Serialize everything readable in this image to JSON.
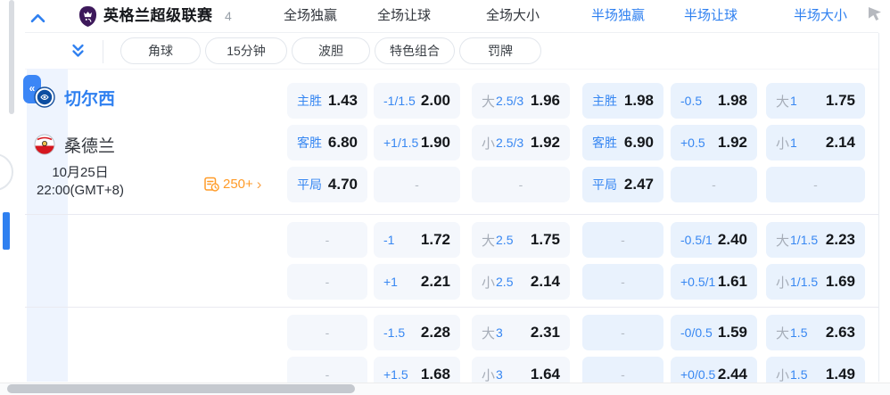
{
  "header": {
    "league_name": "英格兰超级联赛",
    "match_count": "4",
    "market_tabs": [
      {
        "label": "全场独赢",
        "highlighted": false
      },
      {
        "label": "全场让球",
        "highlighted": false
      },
      {
        "label": "全场大小",
        "highlighted": false
      },
      {
        "label": "半场独赢",
        "highlighted": true
      },
      {
        "label": "半场让球",
        "highlighted": true
      },
      {
        "label": "半场大小",
        "highlighted": true
      }
    ]
  },
  "submarket_pills": [
    "角球",
    "15分钟",
    "波胆",
    "特色组合",
    "罚牌"
  ],
  "match": {
    "home_team": "切尔西",
    "away_team": "桑德兰",
    "date": "10月25日",
    "time": "22:00(GMT+8)",
    "more_markets": "250+",
    "more_arrow": "›"
  },
  "odds_rows": [
    [
      {
        "label": "主胜",
        "value": "1.43"
      },
      {
        "label": "-1/1.5",
        "value": "2.00"
      },
      {
        "prefix": "大",
        "label": "2.5/3",
        "value": "1.96"
      },
      {
        "label": "主胜",
        "value": "1.98"
      },
      {
        "label": "-0.5",
        "value": "1.98"
      },
      {
        "prefix": "大",
        "label": "1",
        "value": "1.75"
      }
    ],
    [
      {
        "label": "客胜",
        "value": "6.80"
      },
      {
        "label": "+1/1.5",
        "value": "1.90"
      },
      {
        "prefix": "小",
        "label": "2.5/3",
        "value": "1.92"
      },
      {
        "label": "客胜",
        "value": "6.90"
      },
      {
        "label": "+0.5",
        "value": "1.92"
      },
      {
        "prefix": "小",
        "label": "1",
        "value": "2.14"
      }
    ],
    [
      {
        "label": "平局",
        "value": "4.70"
      },
      {
        "dash": true
      },
      {
        "dash": true
      },
      {
        "label": "平局",
        "value": "2.47"
      },
      {
        "dash": true
      },
      {
        "dash": true
      }
    ],
    [
      {
        "dash": true
      },
      {
        "label": "-1",
        "value": "1.72"
      },
      {
        "prefix": "大",
        "label": "2.5",
        "value": "1.75"
      },
      {
        "dash": true
      },
      {
        "label": "-0.5/1",
        "value": "2.40"
      },
      {
        "prefix": "大",
        "label": "1/1.5",
        "value": "2.23"
      }
    ],
    [
      {
        "dash": true
      },
      {
        "label": "+1",
        "value": "2.21"
      },
      {
        "prefix": "小",
        "label": "2.5",
        "value": "2.14"
      },
      {
        "dash": true
      },
      {
        "label": "+0.5/1",
        "value": "1.61"
      },
      {
        "prefix": "小",
        "label": "1/1.5",
        "value": "1.69"
      }
    ],
    [
      {
        "dash": true
      },
      {
        "label": "-1.5",
        "value": "2.28"
      },
      {
        "prefix": "大",
        "label": "3",
        "value": "2.31"
      },
      {
        "dash": true
      },
      {
        "label": "-0/0.5",
        "value": "1.59"
      },
      {
        "prefix": "大",
        "label": "1.5",
        "value": "2.63"
      }
    ],
    [
      {
        "dash": true
      },
      {
        "label": "+1.5",
        "value": "1.68"
      },
      {
        "prefix": "小",
        "label": "3",
        "value": "1.64"
      },
      {
        "dash": true
      },
      {
        "label": "+0/0.5",
        "value": "2.44"
      },
      {
        "prefix": "小",
        "label": "1.5",
        "value": "1.49"
      }
    ]
  ],
  "colors": {
    "accent_blue": "#2f80f0",
    "cell_bg": "#f4f7fc",
    "half_cell_bg": "#e9f2fd",
    "orange": "#ff9b28",
    "pl_purple": "#3d195b"
  }
}
